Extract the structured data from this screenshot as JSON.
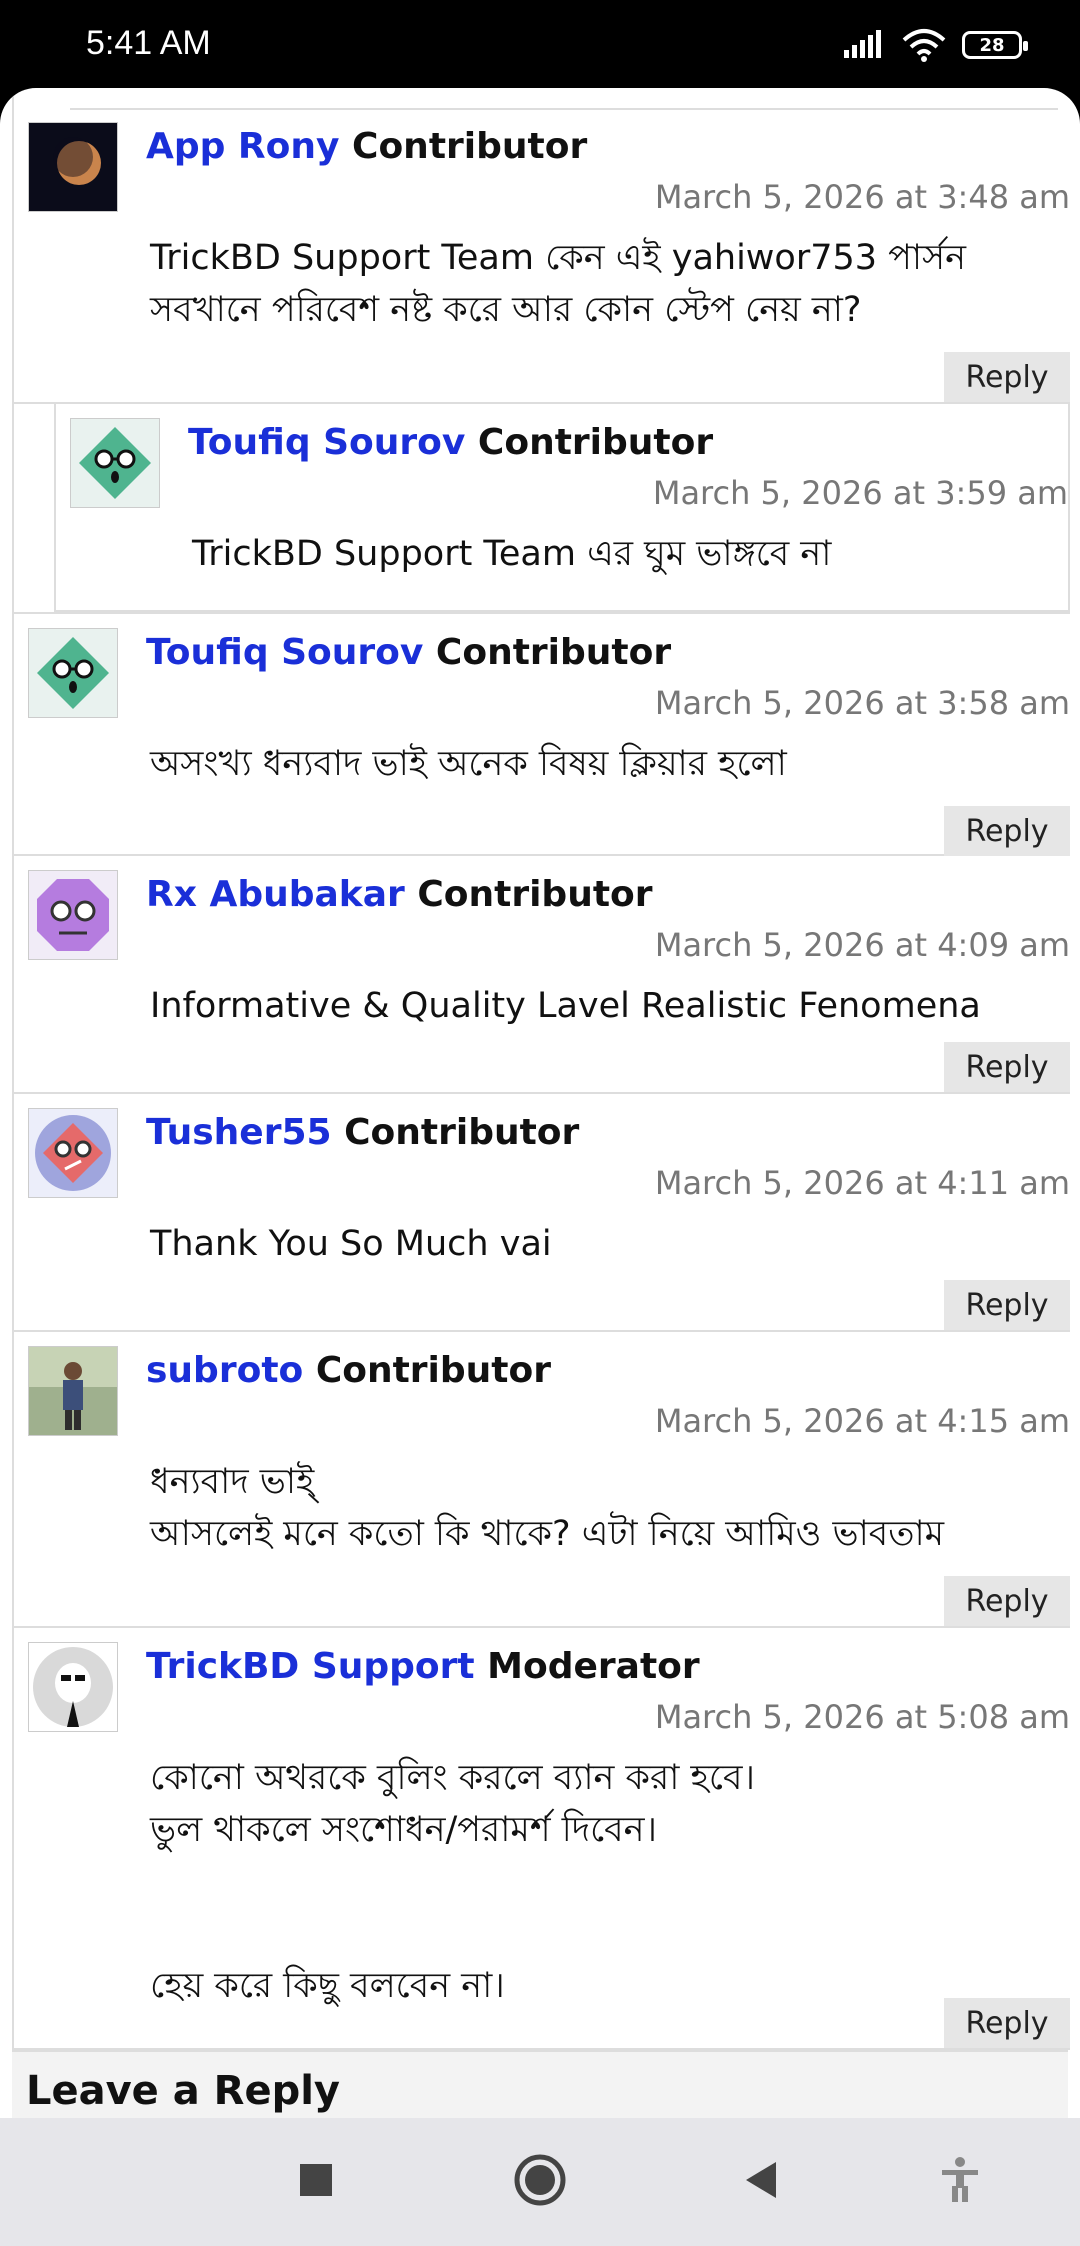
{
  "status_bar": {
    "time": "5:41 AM",
    "battery": "28"
  },
  "comments": [
    {
      "author": "App Rony",
      "role": "Contributor",
      "date": "March 5, 2026 at 3:48 am",
      "body": "TrickBD Support Team কেন এই yahiwor753 পার্সন\nসবখানে পরিবেশ নষ্ট করে আর কোন স্টেপ নেয় না?",
      "reply": "Reply"
    },
    {
      "author": "Toufiq Sourov",
      "role": "Contributor",
      "date": "March 5, 2026 at 3:59 am",
      "body": "TrickBD Support Team এর ঘুম ভাঙ্গবে না"
    },
    {
      "author": "Toufiq Sourov",
      "role": "Contributor",
      "date": "March 5, 2026 at 3:58 am",
      "body": "অসংখ্য ধন্যবাদ ভাই অনেক বিষয় ক্লিয়ার হলো",
      "reply": "Reply"
    },
    {
      "author": "Rx Abubakar",
      "role": "Contributor",
      "date": "March 5, 2026 at 4:09 am",
      "body": "Informative & Quality Lavel Realistic Fenomena",
      "reply": "Reply"
    },
    {
      "author": "Tusher55",
      "role": "Contributor",
      "date": "March 5, 2026 at 4:11 am",
      "body": "Thank You So Much vai",
      "reply": "Reply"
    },
    {
      "author": "subroto",
      "role": "Contributor",
      "date": "March 5, 2026 at 4:15 am",
      "body": "ধন্যবাদ ভাই্\nআসলেই মনে কতো কি থাকে? এটা নিয়ে আমিও ভাবতাম",
      "reply": "Reply"
    },
    {
      "author": "TrickBD Support",
      "role": "Moderator",
      "date": "March 5, 2026 at 5:08 am",
      "body": "কোনো অথরকে বুলিং করলে ব্যান করা হবে।\nভুল থাকলে সংশোধন/পরামর্শ দিবেন।\n\n\nহেয় করে কিছু বলবেন না।",
      "reply": "Reply"
    }
  ],
  "leave_reply": "Leave a Reply",
  "colors": {
    "author": "#1a2fd8",
    "date": "#777777",
    "reply_bg": "#e6e6e6"
  }
}
